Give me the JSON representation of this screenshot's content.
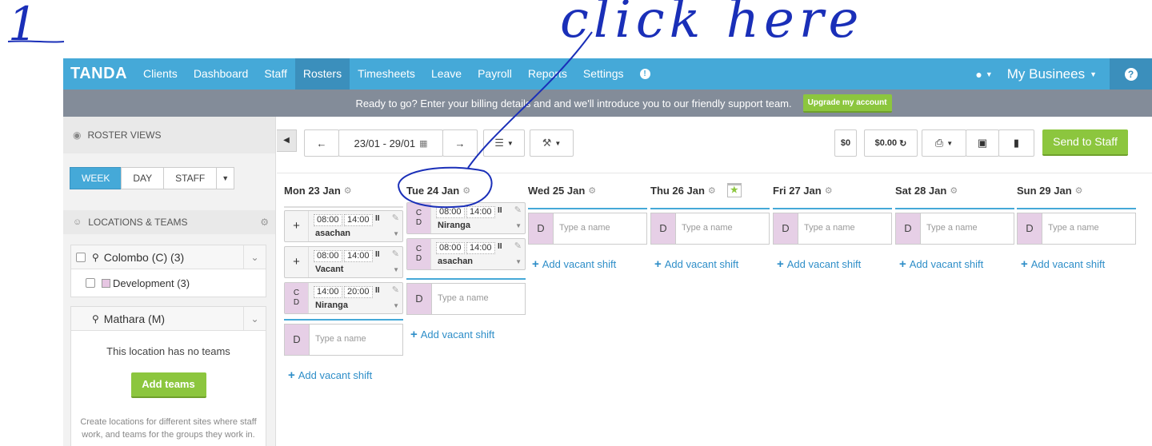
{
  "annotation": {
    "number": "1",
    "text": "click here"
  },
  "nav": {
    "brand": "TANDA",
    "items": [
      "Clients",
      "Dashboard",
      "Staff",
      "Rosters",
      "Timesheets",
      "Leave",
      "Payroll",
      "Reports",
      "Settings"
    ],
    "active": "Rosters",
    "business": "My Businees",
    "help": "?"
  },
  "banner": {
    "text": "Ready to go? Enter your billing details and and we'll introduce you to our friendly support team.",
    "button": "Upgrade my account"
  },
  "sidebar": {
    "roster_views": "ROSTER VIEWS",
    "tabs": [
      "WEEK",
      "DAY",
      "STAFF"
    ],
    "locations_header": "LOCATIONS & TEAMS",
    "locations": [
      {
        "name": "Colombo (C) (3)",
        "team": "Development (3)"
      },
      {
        "name": "Mathara (M)",
        "no_teams": "This location has no teams",
        "button": "Add teams",
        "note": "Create locations for different sites where staff work, and teams for the groups they work in."
      }
    ]
  },
  "toolbar": {
    "date_range": "23/01 - 29/01",
    "cost1": "$0",
    "cost2": "$0.00",
    "send": "Send to Staff"
  },
  "days": [
    {
      "label": "Mon 23 Jan",
      "shifts": [
        {
          "side": "+",
          "start": "08:00",
          "end": "14:00",
          "name": "asachan"
        },
        {
          "side": "+",
          "start": "08:00",
          "end": "14:00",
          "name": "Vacant"
        },
        {
          "side": "C D",
          "start": "14:00",
          "end": "20:00",
          "name": "Niranga"
        }
      ]
    },
    {
      "label": "Tue 24 Jan",
      "shifts": [
        {
          "side": "C D",
          "start": "08:00",
          "end": "14:00",
          "name": "Niranga"
        },
        {
          "side": "C D",
          "start": "08:00",
          "end": "14:00",
          "name": "asachan"
        }
      ]
    },
    {
      "label": "Wed 25 Jan",
      "shifts": []
    },
    {
      "label": "Thu 26 Jan",
      "shifts": []
    },
    {
      "label": "Fri 27 Jan",
      "shifts": []
    },
    {
      "label": "Sat 28 Jan",
      "shifts": []
    },
    {
      "label": "Sun 29 Jan",
      "shifts": []
    }
  ],
  "blank": {
    "team_letter": "D",
    "placeholder": "Type a name",
    "add_vacant": "Add vacant shift"
  },
  "colors": {
    "nav": "#45a9d8",
    "green": "#8cc63e",
    "banner": "#838c99",
    "annotation": "#1a2fb8"
  }
}
